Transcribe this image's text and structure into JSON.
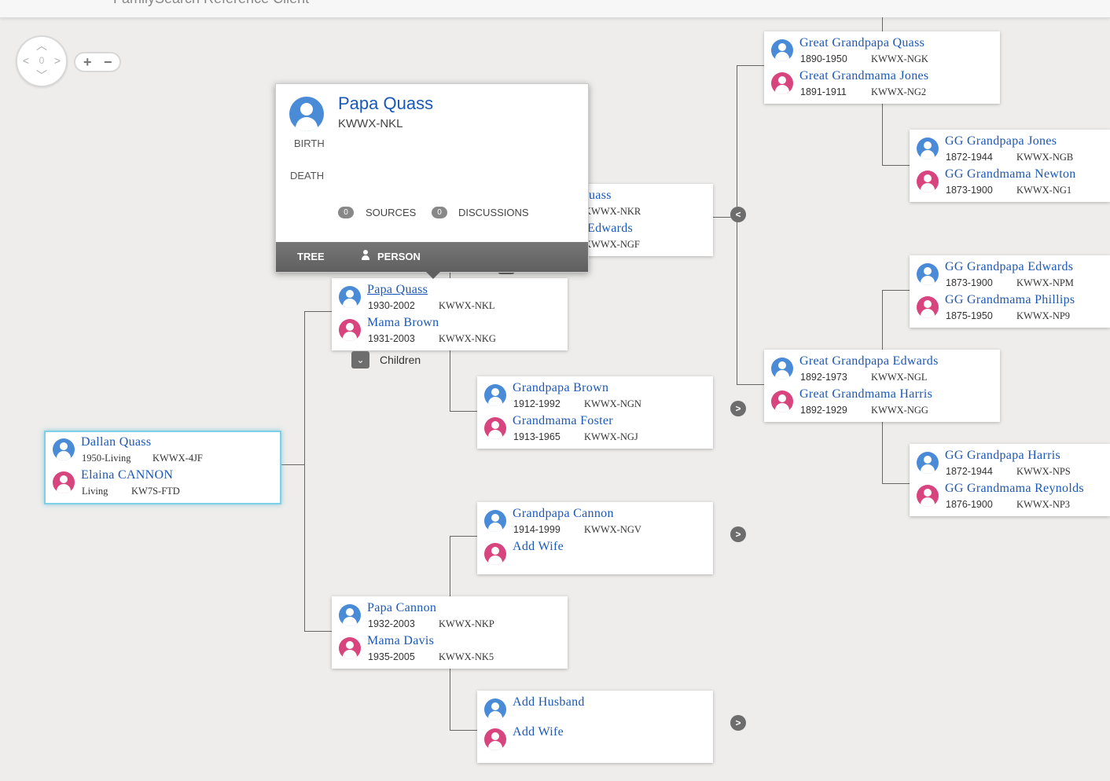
{
  "app": {
    "title": "FamilySearch Reference Client"
  },
  "nav": {
    "center_label": "0",
    "zoom_in": "+",
    "zoom_out": "−"
  },
  "icons": {
    "expand": "chevron-right-icon",
    "collapse": "chevron-left-icon",
    "children": "chevron-down-icon"
  },
  "colors": {
    "male": "#4a8bd8",
    "female": "#d8457e",
    "link": "#1a58b8",
    "selected_border": "#7fd0e6"
  },
  "popup": {
    "name": "Papa Quass",
    "id": "KWWX-NKL",
    "birth_label": "BIRTH",
    "death_label": "DEATH",
    "sources_count": "0",
    "sources_label": "SOURCES",
    "discussions_count": "0",
    "discussions_label": "DISCUSSIONS",
    "tab_tree": "TREE",
    "tab_person": "PERSON"
  },
  "children_label": "Children",
  "cards": {
    "root": {
      "husband": {
        "name": "Dallan Quass",
        "years": "1950-Living",
        "id": "KWWX-4JF"
      },
      "wife": {
        "name": "Elaina CANNON",
        "years": "Living",
        "id": "KW7S-FTD"
      }
    },
    "papa_quass": {
      "husband": {
        "name": "Papa Quass",
        "years": "1930-2002",
        "id": "KWWX-NKL"
      },
      "wife": {
        "name": "Mama Brown",
        "years": "1931-2003",
        "id": "KWWX-NKG"
      }
    },
    "papa_cannon": {
      "husband": {
        "name": "Papa Cannon",
        "years": "1932-2003",
        "id": "KWWX-NKP"
      },
      "wife": {
        "name": "Mama Davis",
        "years": "1935-2005",
        "id": "KWWX-NK5"
      }
    },
    "gp_quass": {
      "husband": {
        "name": "uass",
        "years": "",
        "id": "KWWX-NKR"
      },
      "wife": {
        "name": "Edwards",
        "years": "",
        "id": "KWWX-NGF"
      }
    },
    "gp_brown": {
      "husband": {
        "name": "Grandpapa Brown",
        "years": "1912-1992",
        "id": "KWWX-NGN"
      },
      "wife": {
        "name": "Grandmama Foster",
        "years": "1913-1965",
        "id": "KWWX-NGJ"
      }
    },
    "gp_cannon": {
      "husband": {
        "name": "Grandpapa Cannon",
        "years": "1914-1999",
        "id": "KWWX-NGV"
      },
      "wife": {
        "name": "Add Wife"
      }
    },
    "gp_davis": {
      "husband": {
        "name": "Add Husband"
      },
      "wife": {
        "name": "Add Wife"
      }
    },
    "ggp_quass": {
      "husband": {
        "name": "Great Grandpapa Quass",
        "years": "1890-1950",
        "id": "KWWX-NGK"
      },
      "wife": {
        "name": "Great Grandmama Jones",
        "years": "1891-1911",
        "id": "KWWX-NG2"
      }
    },
    "ggp_edwards": {
      "husband": {
        "name": "Great Grandpapa Edwards",
        "years": "1892-1973",
        "id": "KWWX-NGL"
      },
      "wife": {
        "name": "Great Grandmama Harris",
        "years": "1892-1929",
        "id": "KWWX-NGG"
      }
    },
    "gggp_jones": {
      "husband": {
        "name": "GG Grandpapa Jones",
        "years": "1872-1944",
        "id": "KWWX-NGB"
      },
      "wife": {
        "name": "GG Grandmama Newton",
        "years": "1873-1900",
        "id": "KWWX-NG1"
      }
    },
    "gggp_edwards": {
      "husband": {
        "name": "GG Grandpapa Edwards",
        "years": "1873-1900",
        "id": "KWWX-NPM"
      },
      "wife": {
        "name": "GG Grandmama Phillips",
        "years": "1875-1950",
        "id": "KWWX-NP9"
      }
    },
    "gggp_harris": {
      "husband": {
        "name": "GG Grandpapa Harris",
        "years": "1872-1944",
        "id": "KWWX-NPS"
      },
      "wife": {
        "name": "GG Grandmama Reynolds",
        "years": "1876-1900",
        "id": "KWWX-NP3"
      }
    }
  }
}
